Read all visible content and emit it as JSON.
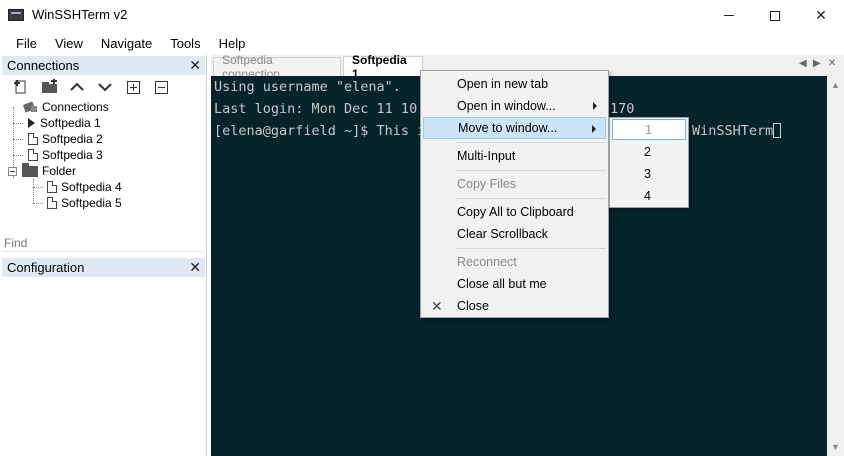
{
  "window": {
    "title": "WinSSHTerm v2",
    "minimize_glyph": "",
    "close_glyph": "✕"
  },
  "menubar": [
    "File",
    "View",
    "Navigate",
    "Tools",
    "Help"
  ],
  "connections_pane": {
    "title": "Connections",
    "close_glyph": "✕",
    "toolbar": [
      "new-connection-icon",
      "new-folder-icon",
      "move-up-icon",
      "move-down-icon",
      "expand-all-icon",
      "collapse-all-icon"
    ],
    "tree": {
      "root": "Connections",
      "items": [
        "Softpedia 1",
        "Softpedia 2",
        "Softpedia 3"
      ],
      "folder": "Folder",
      "folder_items": [
        "Softpedia 4",
        "Softpedia 5"
      ]
    },
    "find_placeholder": "Find"
  },
  "configuration_pane": {
    "title": "Configuration",
    "close_glyph": "✕"
  },
  "tabs": {
    "inactive": "Softpedia connection",
    "active": "Softpedia 1",
    "left_arrow": "◀",
    "right_arrow": "▶",
    "close_glyph": "✕"
  },
  "terminal": {
    "lines": [
      "Using username \"elena\".",
      "Last login: Mon Dec 11 10:",
      "[elena@garfield ~]$ This i"
    ],
    "line2_tail": "170",
    "line3_tail": "WinSSHTerm"
  },
  "context_menu": {
    "items": [
      {
        "label": "Open in new tab",
        "disabled": false
      },
      {
        "label": "Open in window...",
        "disabled": false
      },
      {
        "label": "Move to window...",
        "disabled": false
      },
      {
        "label": "Multi-Input",
        "disabled": false
      },
      {
        "label": "Copy Files",
        "disabled": true
      },
      {
        "label": "Copy All to Clipboard",
        "disabled": false
      },
      {
        "label": "Clear Scrollback",
        "disabled": false
      },
      {
        "label": "Reconnect",
        "disabled": true
      },
      {
        "label": "Close all but me",
        "disabled": false
      },
      {
        "label": "Close",
        "disabled": false
      }
    ],
    "close_icon_glyph": "✕"
  },
  "submenu": [
    "1",
    "2",
    "3",
    "4"
  ],
  "colors": {
    "terminal_bg": "#04232b",
    "terminal_fg": "#c8c8c8",
    "pane_header_bg": "#dfe8f5",
    "menu_highlight": "#cce4f7"
  }
}
